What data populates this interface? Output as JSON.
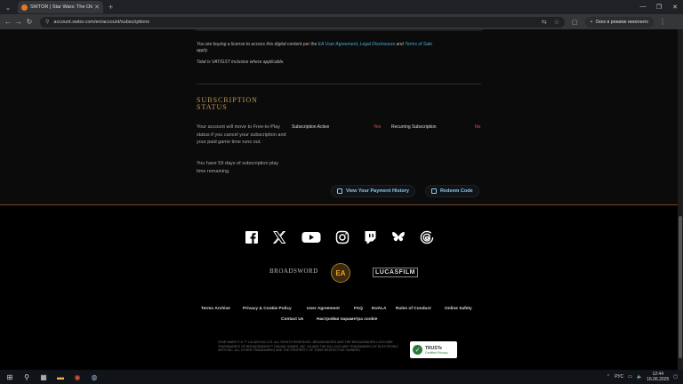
{
  "browser": {
    "tab_title": "SWTOR | Star Wars: The Old Re",
    "url": "account.swtor.com/en/account/subscriptions",
    "incognito_label": "Окно в режиме инкогнито"
  },
  "purchase_notice": {
    "prefix": "You are buying a license to access this digital content per the ",
    "ea_agreement": "EA User Agreement",
    "comma": ", ",
    "legal_disclosures": "Legal Disclosures",
    "and": " and ",
    "terms_of_sale": "Terms of Sale",
    "suffix": "apply.",
    "vat_note": "Total is VAT/GST inclusive where applicable."
  },
  "subscription": {
    "title": "SUBSCRIPTION STATUS",
    "description": "Your account will move to Free-to-Play status if you cancel your subscription and your paid game time runs out.",
    "remaining": "You have 59 days of subscription play time remaining.",
    "active_label": "Subscription Active",
    "active_value": "Yes",
    "recurring_label": "Recurring Subscription",
    "recurring_value": "No",
    "payment_history_button": "View Your Payment History",
    "redeem_button": "Redeem Code"
  },
  "footer": {
    "social_icons": [
      "facebook-icon",
      "x-icon",
      "youtube-icon",
      "instagram-icon",
      "twitch-icon",
      "bluesky-icon",
      "threads-icon"
    ],
    "logos": {
      "broadsword": "BROADSWORD",
      "ea": "EA",
      "lucasfilm": "LUCASFILM"
    },
    "links_row1": [
      "Terms Archive",
      "Privacy & Cookie Policy",
      "User Agreement",
      "FAQ",
      "EUALA",
      "Rules of Conduct",
      "Online Safety"
    ],
    "links_row2": [
      "Contact Us",
      "Настройки параметра cookie"
    ],
    "copyright": "STAR WARS © & ™ LUCASFILM LTD. ALL RIGHTS RESERVED. BROADSWORD AND THE BROADSWORD LOGO ARE TRADEMARKS OF BROADSWORD™ ONLINE GAMES, INC. EA AND THE EA LOGO ARE TRADEMARKS OF ELECTRONIC ARTS INC. ALL OTHER TRADEMARKS ARE THE PROPERTY OF THEIR RESPECTIVE OWNERS.",
    "truste_title": "TRUSTe",
    "truste_sub": "Certified Privacy"
  },
  "taskbar": {
    "lang": "РУС",
    "time": "12:44",
    "date": "16.06.2025"
  },
  "colors": {
    "gold": "#c29a57",
    "link_blue": "#4aa8d8",
    "status_red": "#e0524e",
    "button_text": "#8fc6e8"
  }
}
